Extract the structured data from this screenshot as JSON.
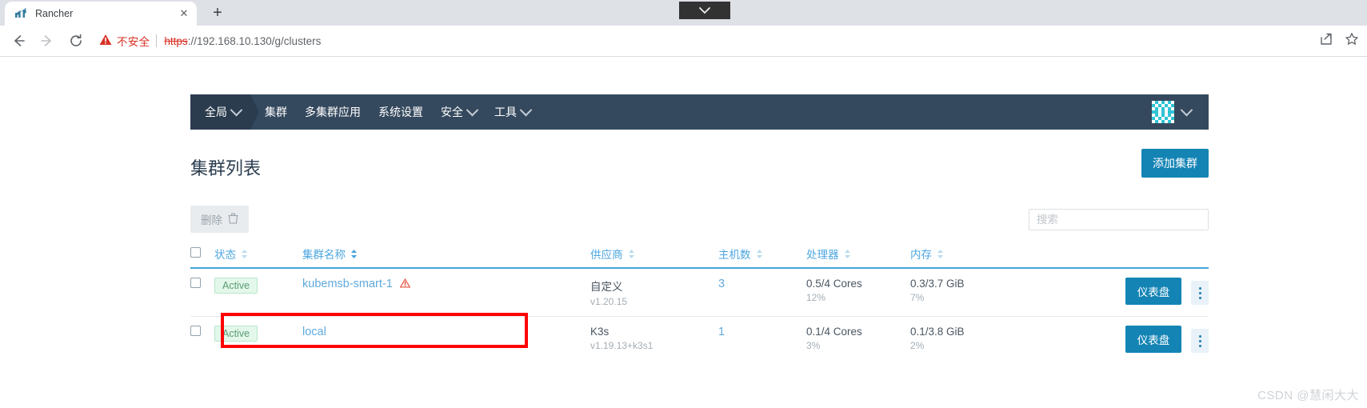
{
  "browser": {
    "tab": {
      "title": "Rancher",
      "favicon_icon": "rancher-favicon",
      "close_icon": "close-icon"
    },
    "new_tab_label": "+",
    "titlebar_dropdown_icon": "chevron-down-icon",
    "back_icon": "back-arrow-icon",
    "forward_icon": "forward-arrow-icon",
    "reload_icon": "reload-icon",
    "security": {
      "warning_icon": "warning-triangle-icon",
      "label": "不安全"
    },
    "url": {
      "scheme": "https",
      "separator": "://",
      "host": "192.168.10.130",
      "path": "/g/clusters"
    },
    "share_icon": "share-icon",
    "bookmark_icon": "star-icon"
  },
  "topnav": {
    "logo_icon": "rancher-logo",
    "home_label": "全局",
    "items": [
      {
        "label": "集群",
        "has_chevron": false
      },
      {
        "label": "多集群应用",
        "has_chevron": false
      },
      {
        "label": "系统设置",
        "has_chevron": false
      },
      {
        "label": "安全",
        "has_chevron": true
      },
      {
        "label": "工具",
        "has_chevron": true
      }
    ],
    "avatar_icon": "user-avatar-identicon",
    "avatar_chevron_icon": "chevron-down-icon",
    "bg_color": "#35495e",
    "home_bg_color": "#2b3c4e"
  },
  "page": {
    "title": "集群列表",
    "add_cluster_label": "添加集群",
    "accent_color": "#1484b5"
  },
  "toolbar": {
    "delete_label": "删除",
    "delete_icon": "trash-icon",
    "search_placeholder": "搜索",
    "search_value": ""
  },
  "table": {
    "columns": [
      {
        "key": "state",
        "label": "状态",
        "sort_icon": "sort-chevrons-icon"
      },
      {
        "key": "name",
        "label": "集群名称",
        "sort_icon": "sort-chevrons-icon"
      },
      {
        "key": "provider",
        "label": "供应商",
        "sort_icon": "sort-chevrons-icon"
      },
      {
        "key": "hosts",
        "label": "主机数",
        "sort_icon": "sort-chevrons-icon"
      },
      {
        "key": "cpu",
        "label": "处理器",
        "sort_icon": "sort-chevrons-icon"
      },
      {
        "key": "memory",
        "label": "内存",
        "sort_icon": "sort-chevrons-icon"
      }
    ],
    "rows": [
      {
        "checkbox_checked": false,
        "state": "Active",
        "name": "kubemsb-smart-1",
        "has_warning": true,
        "warning_icon": "warning-triangle-icon",
        "provider": "自定义",
        "provider_version": "v1.20.15",
        "hosts": "3",
        "cpu": "0.5/4 Cores",
        "cpu_percent": "12%",
        "memory": "0.3/3.7 GiB",
        "memory_percent": "7%",
        "dashboard_label": "仪表盘",
        "kebab_icon": "kebab-menu-icon"
      },
      {
        "checkbox_checked": false,
        "state": "Active",
        "name": "local",
        "has_warning": false,
        "warning_icon": "",
        "provider": "K3s",
        "provider_version": "v1.19.13+k3s1",
        "hosts": "1",
        "cpu": "0.1/4 Cores",
        "cpu_percent": "3%",
        "memory": "0.1/3.8 GiB",
        "memory_percent": "2%",
        "dashboard_label": "仪表盘",
        "kebab_icon": "kebab-menu-icon"
      }
    ]
  },
  "annotation": {
    "color": "#ff0000"
  },
  "watermark": {
    "text": "CSDN @慧闲大大"
  }
}
